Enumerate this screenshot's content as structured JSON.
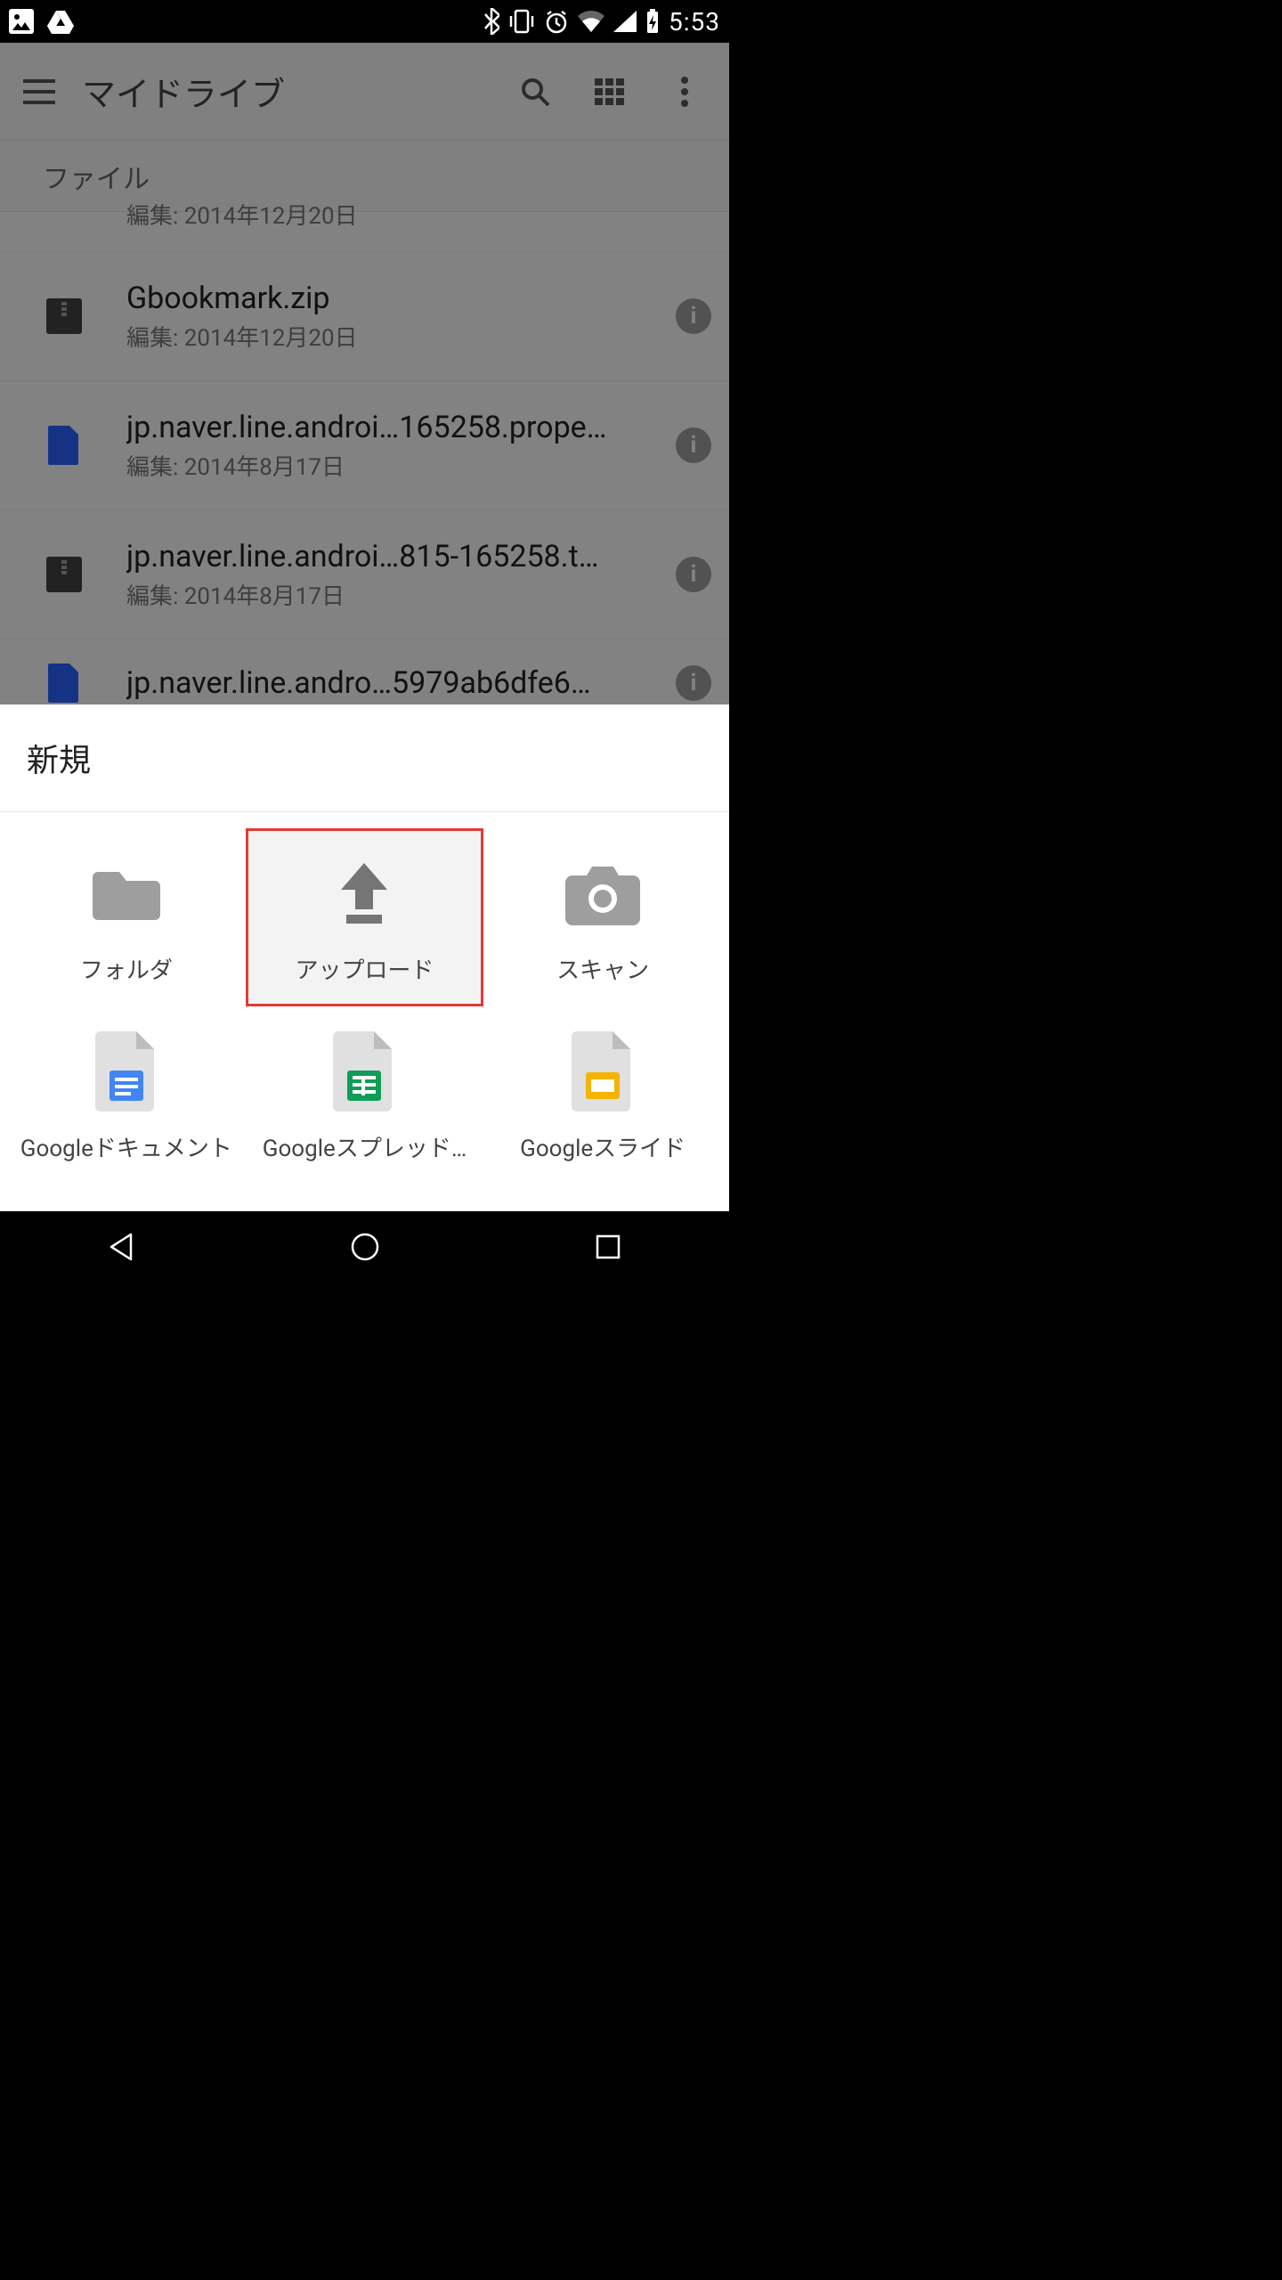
{
  "status": {
    "time": "5:53"
  },
  "appbar": {
    "title": "マイドライブ"
  },
  "section": {
    "label": "ファイル"
  },
  "files": [
    {
      "name": "",
      "sub": "編集: 2014年12月20日",
      "type": "zip",
      "partial": true
    },
    {
      "name": "Gbookmark.zip",
      "sub": "編集: 2014年12月20日",
      "type": "zip"
    },
    {
      "name": "jp.naver.line.androi…165258.properties",
      "sub": "編集: 2014年8月17日",
      "type": "file"
    },
    {
      "name": "jp.naver.line.androi…815-165258.tar.gz",
      "sub": "編集: 2014年8月17日",
      "type": "zip"
    },
    {
      "name": "jp.naver.line.andro…5979ab6dfe60.apk",
      "sub": "",
      "type": "apk",
      "partial_bottom": true
    }
  ],
  "sheet": {
    "title": "新規",
    "items": [
      {
        "label": "フォルダ",
        "icon": "folder"
      },
      {
        "label": "アップロード",
        "icon": "upload",
        "highlight": true
      },
      {
        "label": "スキャン",
        "icon": "camera"
      },
      {
        "label": "Googleドキュメント",
        "icon": "docs"
      },
      {
        "label": "Googleスプレッド…",
        "icon": "sheets"
      },
      {
        "label": "Googleスライド",
        "icon": "slides"
      }
    ]
  }
}
